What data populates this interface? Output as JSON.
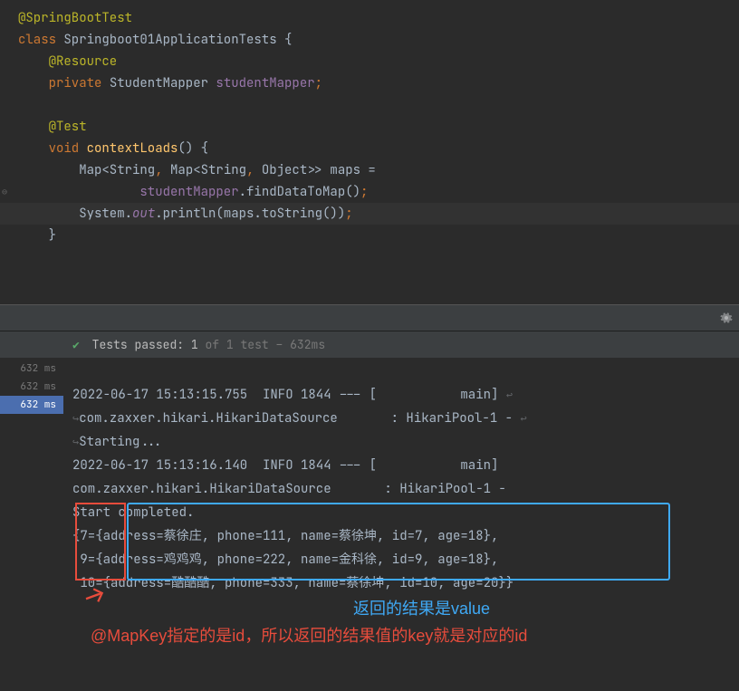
{
  "code": {
    "l1_annot": "@SpringBootTest",
    "l2_kw": "class ",
    "l2_name": "Springboot01ApplicationTests {",
    "l3_annot": "@Resource",
    "l4_kw": "private ",
    "l4_type": "StudentMapper ",
    "l4_field": "studentMapper",
    "l4_semi": ";",
    "l6_annot": "@Test",
    "l7_kw": "void ",
    "l7_method": "contextLoads",
    "l7_rest": "() {",
    "l8a": "Map<String",
    "l8b": ", ",
    "l8c": "Map<String",
    "l8d": ", ",
    "l8e": "Object>> maps =",
    "l9_field": "studentMapper",
    "l9_dot": ".",
    "l9_call": "findDataToMap()",
    "l9_semi": ";",
    "l10a": "System.",
    "l10_out": "out",
    "l10b": ".println(maps.toString())",
    "l10_semi": ";",
    "l11_brace": "}"
  },
  "tests": {
    "passed_label": "Tests passed:",
    "count": "1",
    "of": "of 1 test",
    "dash": "–",
    "time": "632ms"
  },
  "timings": [
    "632 ms",
    "632 ms",
    "632 ms"
  ],
  "console": {
    "l1": "2022-06-17 15:13:15.755  INFO 1844 --- [           main] ",
    "l2": "com.zaxxer.hikari.HikariDataSource       : HikariPool-1 - ",
    "l3": "Starting...",
    "l4": "2022-06-17 15:13:16.140  INFO 1844 --- [           main] ",
    "l5": "com.zaxxer.hikari.HikariDataSource       : HikariPool-1 - ",
    "l6": "Start completed.",
    "r1a": "{7=",
    "r1b": "{address=蔡徐庄, phone=111, name=蔡徐坤, id=7, age=18},",
    "r2a": " 9=",
    "r2b": "{address=鸡鸡鸡, phone=222, name=金科徐, id=9, age=18},",
    "r3a": " 10=",
    "r3b": "{address=酷酷酷, phone=333, name=蔡徐坤, id=10, age=20}}"
  },
  "annotations": {
    "blue": "返回的结果是value",
    "red": "@MapKey指定的是id，所以返回的结果值的key就是对应的id"
  }
}
